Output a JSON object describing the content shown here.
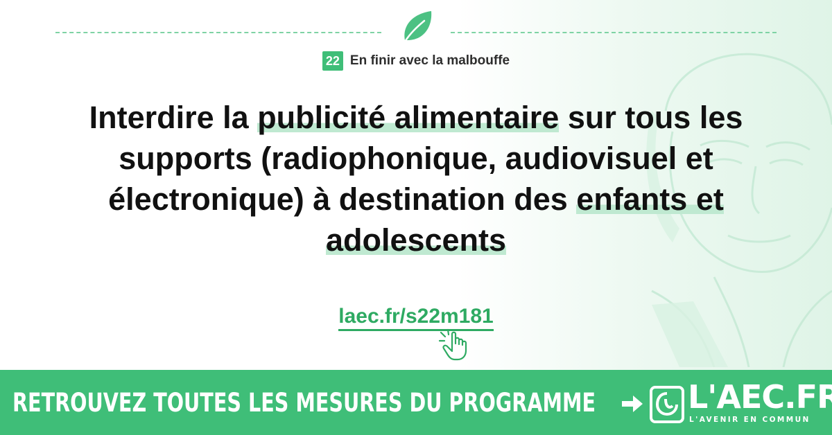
{
  "category": {
    "number": "22",
    "title": "En finir avec la malbouffe"
  },
  "headline": {
    "part1": "Interdire la ",
    "highlight1": "publicité alimentaire",
    "part2": " sur tous les supports (radiophonique, audiovisuel et électronique) à destination des ",
    "highlight2": "enfants et adolescents"
  },
  "link": {
    "text": "laec.fr/s22m181"
  },
  "banner": {
    "text": "RETROUVEZ TOUTES LES MESURES DU PROGRAMME",
    "logo_text": "L'AEC.FR",
    "logo_subtitle": "L'AVENIR EN COMMUN"
  },
  "colors": {
    "accent": "#3fbe78",
    "link": "#2eaa62",
    "highlight": "#bfe9d1",
    "text": "#111111"
  },
  "icons": [
    "leaf-icon",
    "pointer-hand-icon",
    "arrow-right-icon",
    "aec-emblem-icon",
    "portrait-watermark"
  ]
}
